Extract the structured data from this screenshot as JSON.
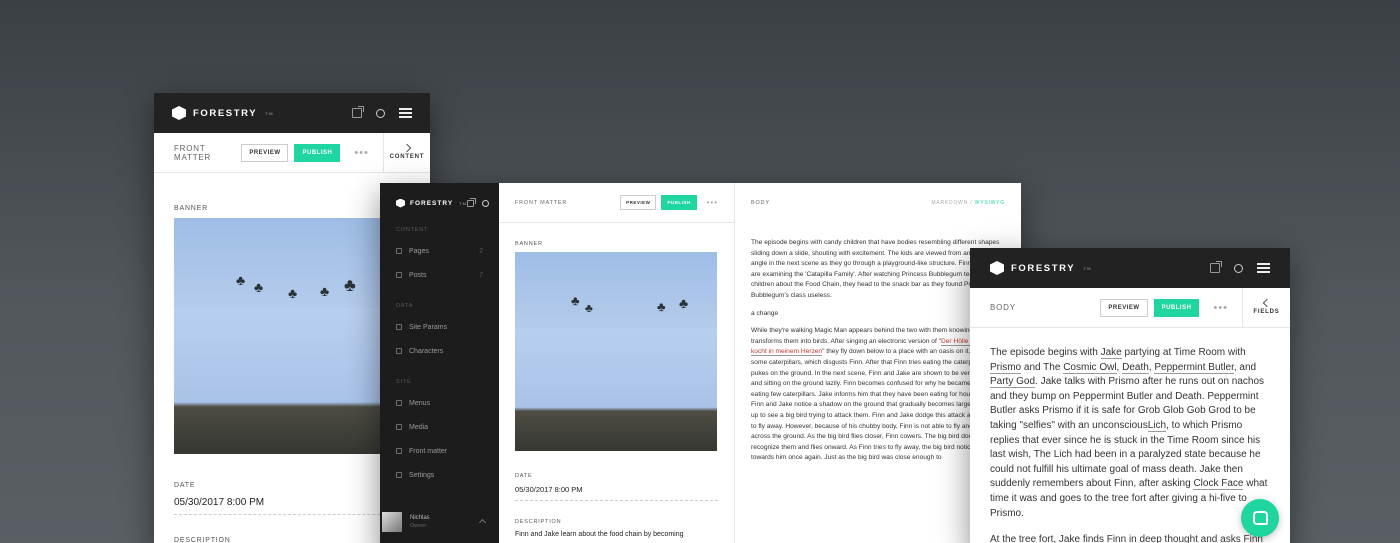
{
  "brand": {
    "name": "FORESTRY",
    "tm": "TM"
  },
  "toolbar": {
    "front_matter": "FRONT MATTER",
    "body": "BODY",
    "preview": "PREVIEW",
    "publish": "PUBLISH",
    "more": "•••",
    "content": "CONTENT",
    "fields": "FIELDS",
    "mode_markdown": "MARKDOWN",
    "mode_sep": " / ",
    "mode_wysiwyg": "WYSIWYG"
  },
  "fields": {
    "banner": "BANNER",
    "date": "DATE",
    "date_value": "05/30/2017 8:00 PM",
    "description": "DESCRIPTION",
    "description_value": "Finn and Jake learn about the food chain by becoming"
  },
  "sidebar": {
    "sections": [
      {
        "title": "CONTENT",
        "items": [
          {
            "label": "Pages",
            "count": "2",
            "icon": "page-icon"
          },
          {
            "label": "Posts",
            "count": "7",
            "icon": "post-icon"
          }
        ]
      },
      {
        "title": "DATA",
        "items": [
          {
            "label": "Site Params",
            "count": "",
            "icon": "params-icon"
          },
          {
            "label": "Characters",
            "count": "",
            "icon": "characters-icon"
          }
        ]
      },
      {
        "title": "SITE",
        "items": [
          {
            "label": "Menus",
            "count": "",
            "icon": "menu-icon"
          },
          {
            "label": "Media",
            "count": "",
            "icon": "media-icon"
          },
          {
            "label": "Front matter",
            "count": "",
            "icon": "frontmatter-icon"
          },
          {
            "label": "Settings",
            "count": "",
            "icon": "settings-icon"
          }
        ]
      }
    ],
    "user": {
      "name": "Nichlas",
      "role": "Owner"
    }
  },
  "middle_body": {
    "p1": "The episode begins with candy children that have bodies resembling different shapes sliding down a slide, shouting with excitement. The kids are viewed from an horizontal angle in the next scene as they go through a playground-like structure. Finn and Jake are examining the 'Catapilla Family'. After watching Princess Bubblegum teach the children about the Food Chain, they head to the snack bar as they found Princess Bubblegum's class useless.",
    "p2": "a change",
    "p3a": "While they're walking Magic Man appears behind the two with them knowing, and transforms them into birds. After singing an electronic version of \"",
    "p3link": "Der Hölle Rache kocht in meinem Herzen",
    "p3b": "\" they fly down below to a place with an oasis on it. Jake eats some caterpillars, which disgusts Finn. After that Finn tries eating the caterpillars and pukes on the ground. In the next scene, Finn and Jake are shown to be very chubby and sitting on the ground lazily. Finn becomes confused for why he became full from eating few caterpillars. Jake informs him that they have been eating for hours. Soon, Finn and Jake notice a shadow on the ground that gradually becomes larger. They look up to see a big bird trying to attack them. Finn and Jake dodge this attack and attempt to fly away. However, because of his chubby body, Finn is not able to fly and skids across the ground. As the big bird flies closer, Finn cowers. The big bird does not recognize them and flies onward. As Finn tries to fly away, the big bird notices and flies towards him once again. Just as the big bird was close enough to"
  },
  "right_body": {
    "p1": [
      {
        "t": "The episode begins with "
      },
      {
        "t": "Jake",
        "u": true
      },
      {
        "t": " partying at Time Room with "
      },
      {
        "t": "Prismo",
        "u": true
      },
      {
        "t": " and The "
      },
      {
        "t": "Cosmic Owl",
        "u": true
      },
      {
        "t": ", "
      },
      {
        "t": "Death",
        "u": true
      },
      {
        "t": ", "
      },
      {
        "t": "Peppermint Butler",
        "u": true
      },
      {
        "t": ", and "
      },
      {
        "t": "Party God",
        "u": true
      },
      {
        "t": ". Jake talks with Prismo after he runs out on nachos and they bump on Peppermint Butler and Death. Peppermint Butler asks Prismo if it is safe for Grob Glob Gob Grod to be taking \"selfies\" with an unconscious"
      },
      {
        "t": "Lich",
        "u": true
      },
      {
        "t": ", to which Prismo replies that ever since he is stuck in the Time Room since his last wish, The Lich had been in a paralyzed state because he could not fulfill his ultimate goal of mass death. Jake then suddenly remembers about Finn, after asking "
      },
      {
        "t": "Clock Face",
        "u": true
      },
      {
        "t": " what time it was and goes to the tree fort after giving a hi-five to Prismo."
      }
    ],
    "p2": "At the tree fort, Jake finds Finn in deep thought and asks Finn"
  },
  "colors": {
    "accent": "#1fd5a0",
    "dark": "#222222"
  }
}
